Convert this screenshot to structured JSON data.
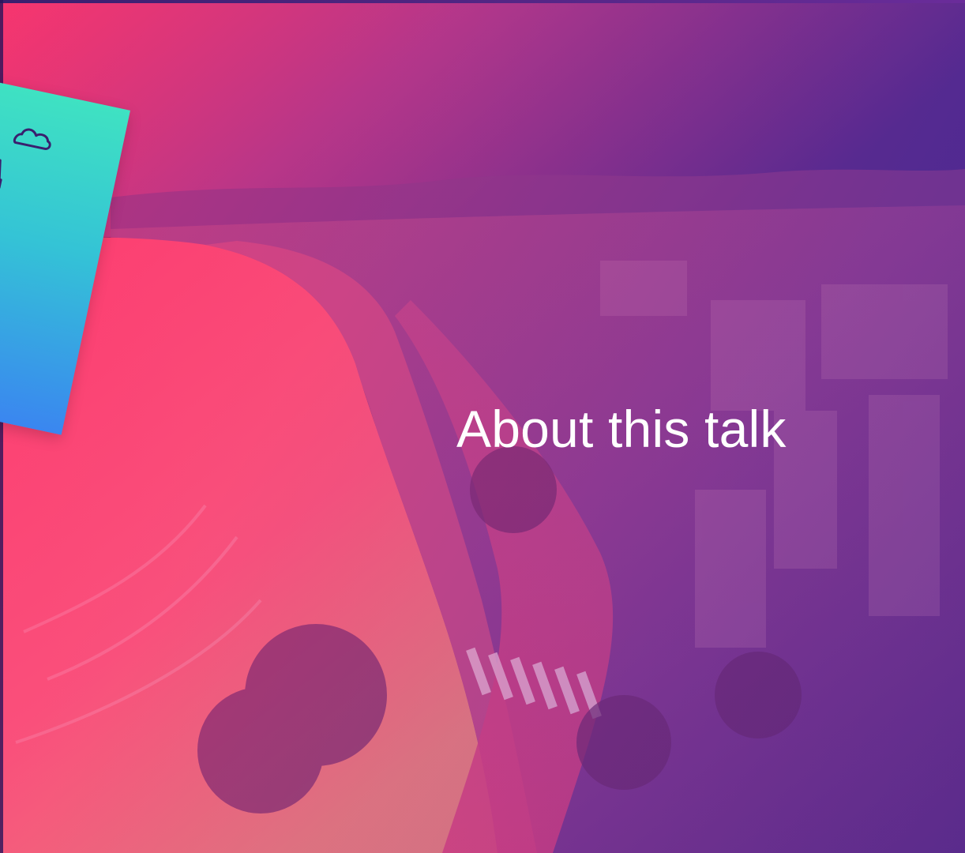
{
  "slide": {
    "title": "About this talk"
  },
  "brand_card": {
    "icons": [
      "cloud-icon",
      "lighthouse-icon"
    ]
  },
  "colors": {
    "title_text": "#ffffff",
    "card_top": "#3fe2c2",
    "card_bottom": "#3a86f0",
    "overlay_pink": "#ff286e",
    "overlay_purple": "#3c2396"
  }
}
